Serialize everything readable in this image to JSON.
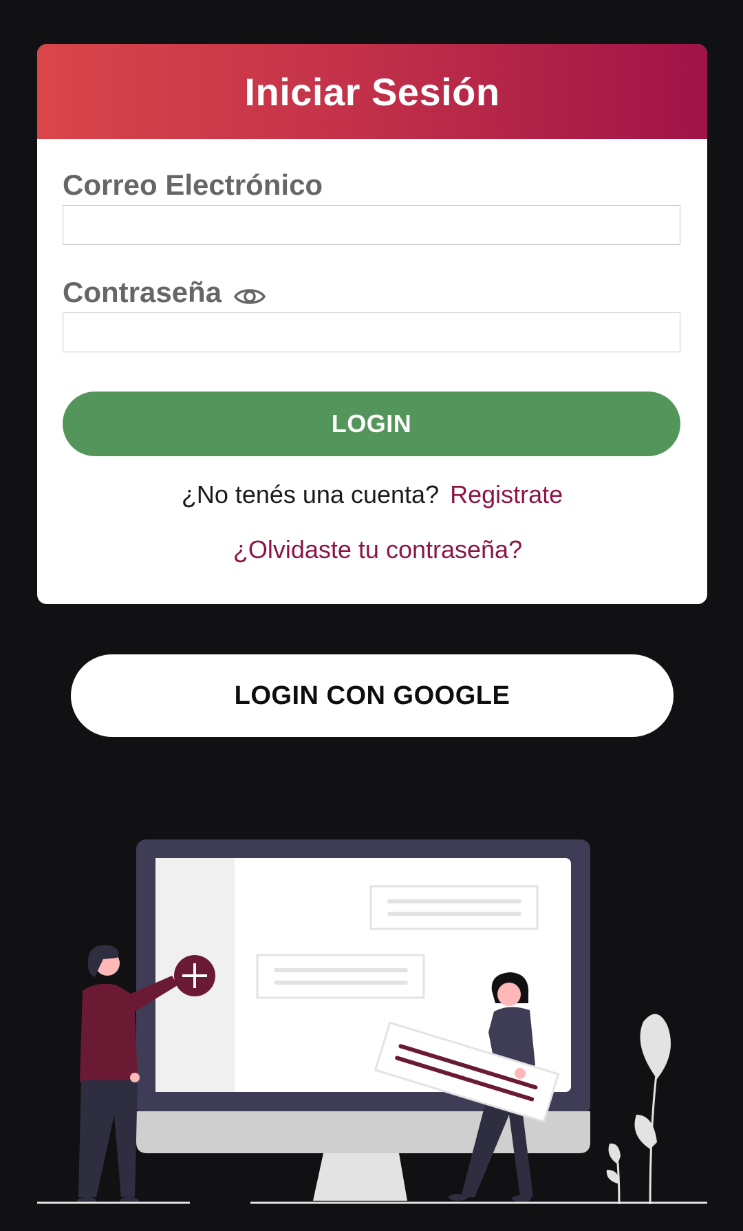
{
  "header": {
    "title": "Iniciar Sesión"
  },
  "form": {
    "email_label": "Correo Electrónico",
    "email_value": "",
    "password_label": "Contraseña",
    "password_value": "",
    "login_label": "LOGIN"
  },
  "register": {
    "prompt": "¿No tenés una cuenta?",
    "link_label": "Registrate"
  },
  "forgot": {
    "link_label": "¿Olvidaste tu contraseña?"
  },
  "google": {
    "button_label": "LOGIN CON GOOGLE"
  },
  "icons": {
    "password_toggle": "eye-icon",
    "add": "plus-icon"
  },
  "colors": {
    "background": "#111113",
    "header_gradient_start": "#d9464a",
    "header_gradient_end": "#a01347",
    "login_button": "#53955a",
    "link": "#8c1546",
    "label": "#666666",
    "illustration_accent": "#6b1a33",
    "illustration_dark": "#3f3d56"
  }
}
